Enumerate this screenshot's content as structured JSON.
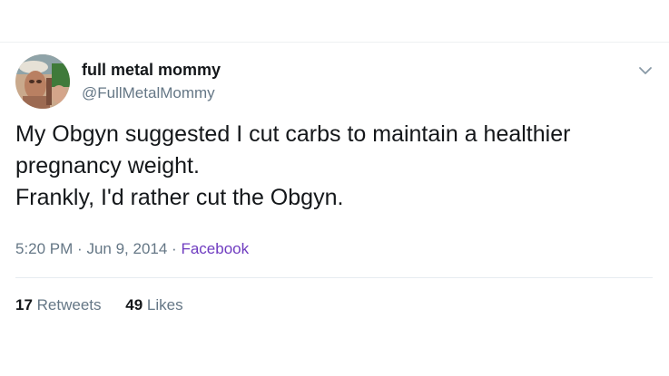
{
  "tweet": {
    "display_name": "full metal mommy",
    "handle": "@FullMetalMommy",
    "text_lines": [
      "My Obgyn suggested I cut carbs to maintain a healthier",
      "pregnancy weight.",
      "Frankly, I'd rather cut the Obgyn."
    ],
    "time": "5:20 PM",
    "date": "Jun 9, 2014",
    "source": "Facebook",
    "separator": "·",
    "retweets_count": "17",
    "retweets_label": "Retweets",
    "likes_count": "49",
    "likes_label": "Likes"
  },
  "icons": {
    "menu": "chevron-down-icon",
    "avatar": "profile-photo"
  },
  "colors": {
    "text": "#14171a",
    "muted": "#657786",
    "source_link": "#6f3cc0",
    "divider": "#e6ecf0"
  }
}
